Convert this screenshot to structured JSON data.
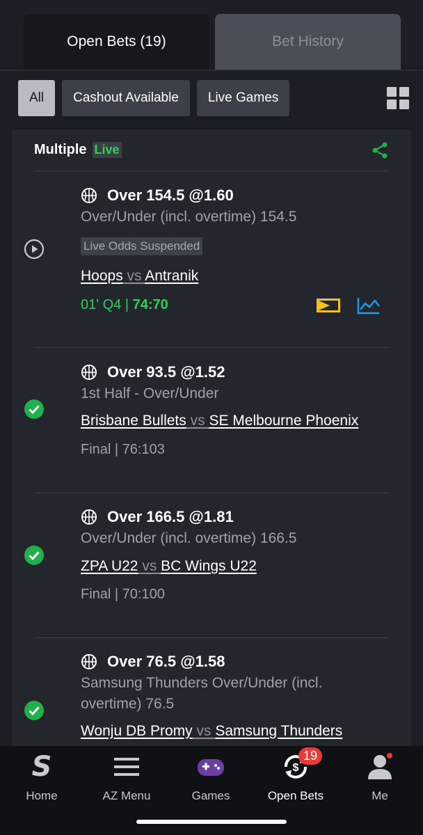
{
  "tabs": {
    "open_bets": "Open Bets (19)",
    "bet_history": "Bet History"
  },
  "filters": [
    "All",
    "Cashout Available",
    "Live Games"
  ],
  "card": {
    "title": "Multiple",
    "live_label": "Live"
  },
  "bets": [
    {
      "title": "Over 154.5 @1.60",
      "subtitle": "Over/Under (incl. overtime) 154.5",
      "suspended": "Live Odds Suspended",
      "home": "Hoops",
      "vs": "vs",
      "away": "Antranik",
      "score_prefix": "01' Q4 | ",
      "score": "74:70"
    },
    {
      "title": "Over 93.5 @1.52",
      "subtitle": "1st Half  -  Over/Under",
      "home": "Brisbane Bullets",
      "vs": "vs",
      "away": "SE Melbourne Phoenix",
      "result": "Final | 76:103"
    },
    {
      "title": "Over 166.5 @1.81",
      "subtitle": "Over/Under (incl. overtime)  166.5",
      "home": "ZPA U22",
      "vs": "vs",
      "away": "BC Wings U22",
      "result": "Final | 70:100"
    },
    {
      "title": "Over 76.5 @1.58",
      "subtitle": "Samsung Thunders Over/Under (incl. overtime) 76.5",
      "home": "Wonju DB Promy",
      "vs": "vs",
      "away": "Samsung Thunders"
    }
  ],
  "nav": {
    "home": "Home",
    "az_menu": "AZ Menu",
    "games": "Games",
    "open_bets": "Open Bets",
    "open_bets_badge": "19",
    "me": "Me"
  },
  "colors": {
    "live_green": "#2fcf5a",
    "check_green": "#22b04b",
    "badge_red": "#e53b3b",
    "chart_blue": "#1e9be8",
    "tv_yellow": "#f2c318"
  }
}
